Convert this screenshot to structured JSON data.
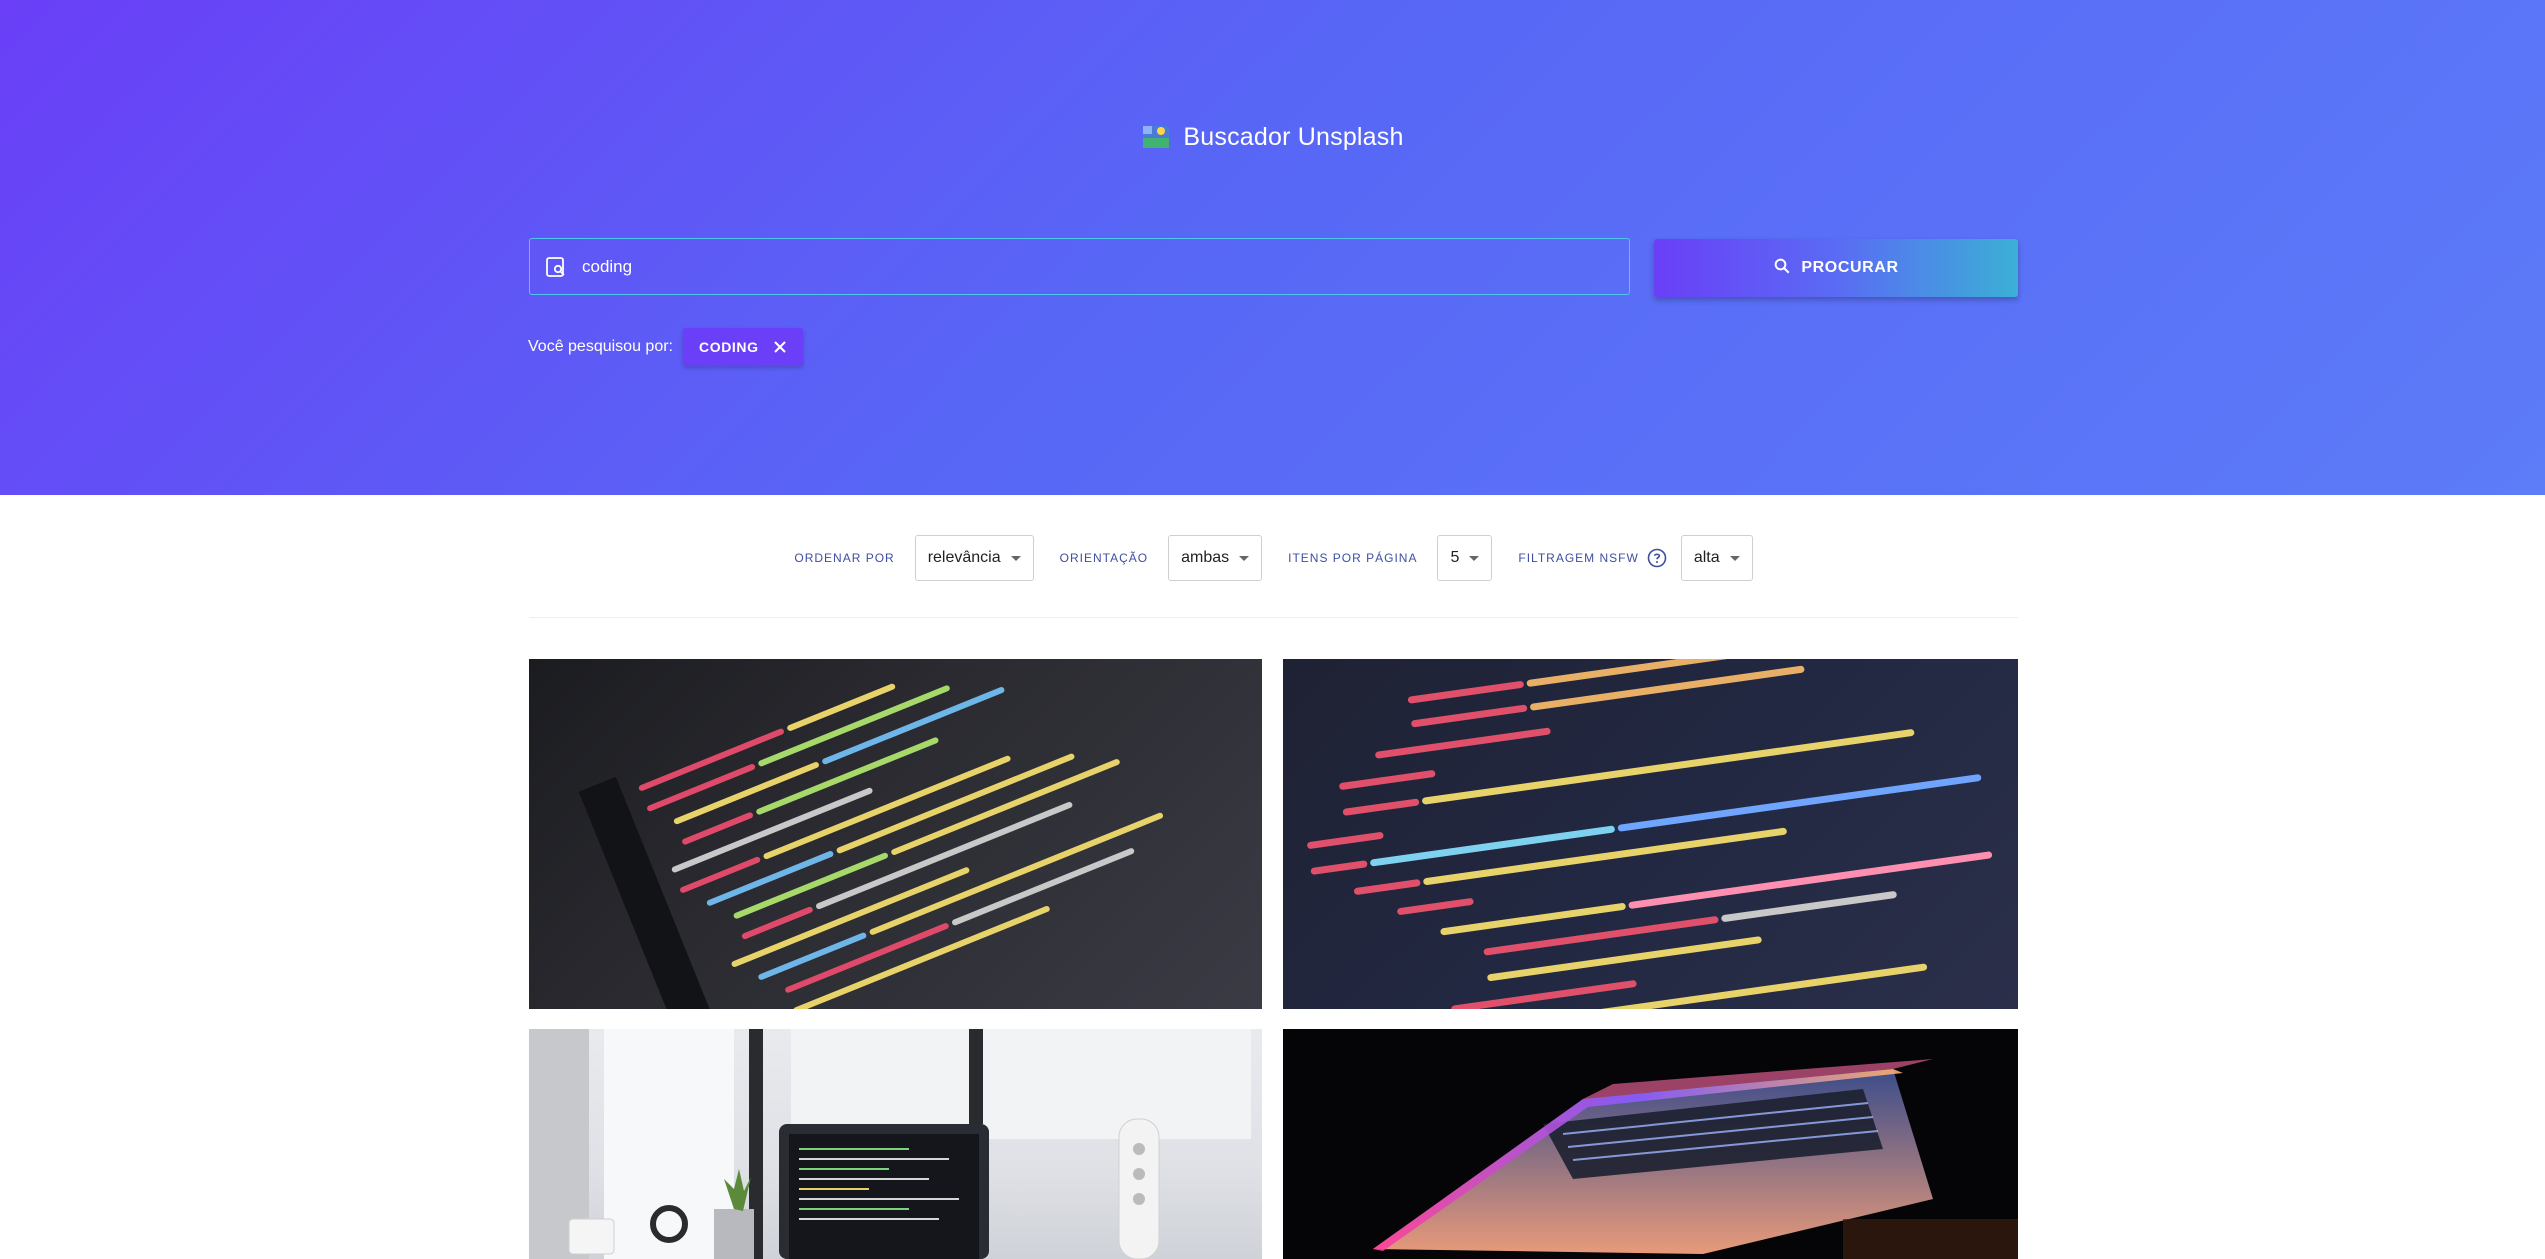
{
  "header": {
    "title": "Buscador Unsplash",
    "logo_icon": "image-icon"
  },
  "search": {
    "value": "coding",
    "placeholder": "",
    "button_label": "PROCURAR",
    "searched_label": "Você pesquisou por:",
    "chip_label": "CODING"
  },
  "filters": {
    "order_label": "ORDENAR POR",
    "order_value": "relevância",
    "orientation_label": "ORIENTAÇÃO",
    "orientation_value": "ambas",
    "per_page_label": "ITENS POR PÁGINA",
    "per_page_value": "5",
    "nsfw_label": "FILTRAGEM NSFW",
    "nsfw_value": "alta"
  },
  "results": [
    {
      "icon": "photo-code-screen"
    },
    {
      "icon": "photo-code-svg"
    },
    {
      "icon": "photo-laptop-desk"
    },
    {
      "icon": "photo-laptop-dark"
    }
  ],
  "colors": {
    "accent": "#6a3ff7",
    "hero_start": "#6a3ff7",
    "hero_end": "#5c7cf8",
    "button_end": "#3bb0d6"
  }
}
